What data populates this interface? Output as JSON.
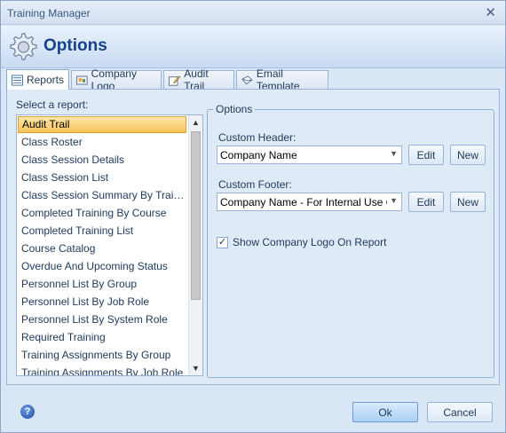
{
  "window": {
    "title": "Training Manager"
  },
  "header": {
    "title": "Options",
    "icon": "gear-icon"
  },
  "tabs": [
    {
      "label": "Reports",
      "icon": "report-icon",
      "active": true
    },
    {
      "label": "Company Logo",
      "icon": "logo-icon",
      "active": false
    },
    {
      "label": "Audit Trail",
      "icon": "pencil-icon",
      "active": false
    },
    {
      "label": "Email Template",
      "icon": "email-icon",
      "active": false
    }
  ],
  "reports": {
    "label": "Select a report:",
    "items": [
      "Audit Trail",
      "Class Roster",
      "Class Session Details",
      "Class Session List",
      "Class Session Summary By Trainer",
      "Completed Training By Course",
      "Completed Training List",
      "Course Catalog",
      "Overdue And Upcoming Status",
      "Personnel List By Group",
      "Personnel List By Job Role",
      "Personnel List By System Role",
      "Required Training",
      "Training Assignments By Group",
      "Training Assignments By Job Role"
    ],
    "selected_index": 0
  },
  "options": {
    "legend": "Options",
    "header_label": "Custom Header:",
    "header_value": "Company Name",
    "footer_label": "Custom Footer:",
    "footer_value": "Company Name - For Internal Use Only",
    "edit_label": "Edit",
    "new_label": "New",
    "show_logo_label": "Show Company Logo On Report",
    "show_logo_checked": true
  },
  "footer": {
    "ok_label": "Ok",
    "cancel_label": "Cancel"
  }
}
